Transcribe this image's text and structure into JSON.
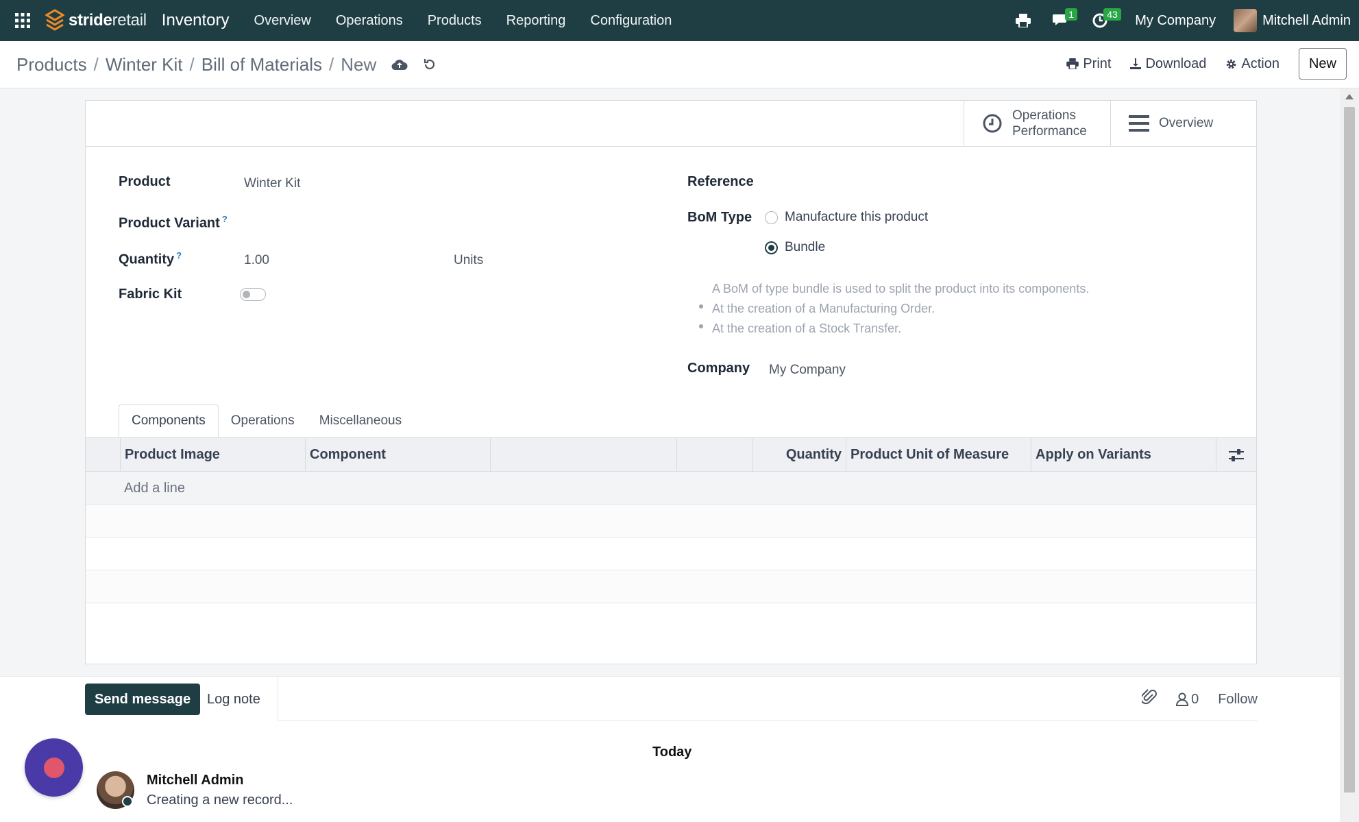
{
  "navbar": {
    "logo_prefix": "stride",
    "logo_suffix": "retail",
    "app_name": "Inventory",
    "menu": [
      "Overview",
      "Operations",
      "Products",
      "Reporting",
      "Configuration"
    ],
    "messages_badge": "1",
    "activities_badge": "43",
    "company": "My Company",
    "user": "Mitchell Admin",
    "icons": [
      "apps-grid-icon",
      "printer-icon",
      "chat-icon",
      "clock-icon"
    ]
  },
  "control_panel": {
    "breadcrumbs": [
      "Products",
      "Winter Kit",
      "Bill of Materials"
    ],
    "current": "New",
    "separator": "/",
    "print_label": "Print",
    "download_label": "Download",
    "action_label": "Action",
    "new_label": "New"
  },
  "button_box": {
    "operations_performance": [
      "Operations",
      "Performance"
    ],
    "overview": "Overview"
  },
  "form": {
    "product_label": "Product",
    "product_value": "Winter Kit",
    "variant_label": "Product Variant",
    "quantity_label": "Quantity",
    "quantity_value": "1.00",
    "uom_value": "Units",
    "fabric_kit_label": "Fabric Kit",
    "fabric_kit_enabled": false,
    "help_marker": "?",
    "reference_label": "Reference",
    "bom_type_label": "BoM Type",
    "bom_type_options": [
      "Manufacture this product",
      "Bundle"
    ],
    "bom_type_selected": "Bundle",
    "bundle_help": "A BoM of type bundle is used to split the product into its components.",
    "bundle_points": [
      "At the creation of a Manufacturing Order.",
      "At the creation of a Stock Transfer."
    ],
    "company_label": "Company",
    "company_value": "My Company"
  },
  "tabs": [
    "Components",
    "Operations",
    "Miscellaneous"
  ],
  "active_tab": "Components",
  "components_table": {
    "columns": [
      "Product Image",
      "Component",
      "",
      "",
      "Quantity",
      "Product Unit of Measure",
      "Apply on Variants"
    ],
    "add_line_label": "Add a line",
    "rows": []
  },
  "chatter": {
    "send_message_label": "Send message",
    "log_note_label": "Log note",
    "followers_count": "0",
    "follow_label": "Follow",
    "date_separator": "Today",
    "messages": [
      {
        "author": "Mitchell Admin",
        "body": "Creating a new record..."
      }
    ]
  },
  "colors": {
    "navbar": "#1f3e44",
    "primary_button": "#1f3e44",
    "badge": "#28a745",
    "record_fab": "#4a3aa8"
  }
}
